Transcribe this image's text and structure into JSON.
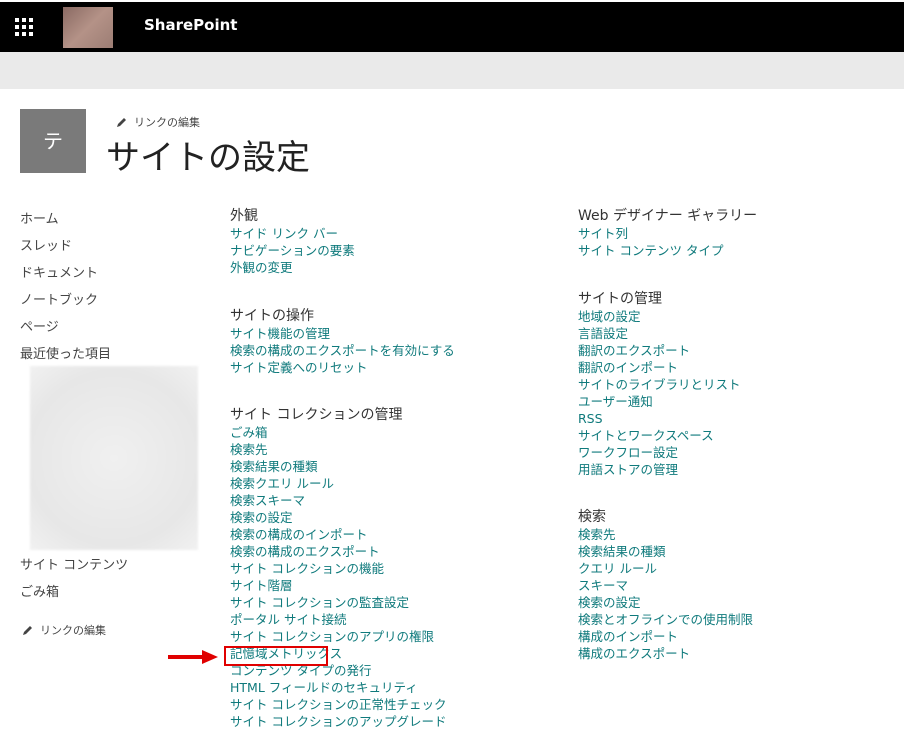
{
  "suite": {
    "title": "SharePoint"
  },
  "site": {
    "logo_letter": "テ",
    "page_title": "サイトの設定",
    "edit_links": "リンクの編集"
  },
  "left_nav": {
    "items": [
      "ホーム",
      "スレッド",
      "ドキュメント",
      "ノートブック",
      "ページ",
      "最近使った項目"
    ],
    "bottom_items": [
      "サイト コンテンツ",
      "ごみ箱"
    ],
    "edit_links": "リンクの編集"
  },
  "sections": {
    "appearance": {
      "title": "外観",
      "links": [
        "サイド リンク バー",
        "ナビゲーションの要素",
        "外観の変更"
      ]
    },
    "site_actions": {
      "title": "サイトの操作",
      "links": [
        "サイト機能の管理",
        "検索の構成のエクスポートを有効にする",
        "サイト定義へのリセット"
      ]
    },
    "site_collection_admin": {
      "title": "サイト コレクションの管理",
      "links": [
        "ごみ箱",
        "検索先",
        "検索結果の種類",
        "検索クエリ ルール",
        "検索スキーマ",
        "検索の設定",
        "検索の構成のインポート",
        "検索の構成のエクスポート",
        "サイト コレクションの機能",
        "サイト階層",
        "サイト コレクションの監査設定",
        "ポータル サイト接続",
        "サイト コレクションのアプリの権限",
        "記憶域メトリックス",
        "コンテンツ タイプの発行",
        "HTML フィールドのセキュリティ",
        "サイト コレクションの正常性チェック",
        "サイト コレクションのアップグレード"
      ]
    },
    "web_designer": {
      "title": "Web デザイナー ギャラリー",
      "links": [
        "サイト列",
        "サイト コンテンツ タイプ"
      ]
    },
    "site_admin": {
      "title": "サイトの管理",
      "links": [
        "地域の設定",
        "言語設定",
        "翻訳のエクスポート",
        "翻訳のインポート",
        "サイトのライブラリとリスト",
        "ユーザー通知",
        "RSS",
        "サイトとワークスペース",
        "ワークフロー設定",
        "用語ストアの管理"
      ]
    },
    "search": {
      "title": "検索",
      "links": [
        "検索先",
        "検索結果の種類",
        "クエリ ルール",
        "スキーマ",
        "検索の設定",
        "検索とオフラインでの使用制限",
        "構成のインポート",
        "構成のエクスポート"
      ]
    }
  },
  "colors": {
    "link": "#0f7a7c",
    "highlight": "#e00000",
    "topbar": "#000000",
    "ribbon": "#eaeaea"
  },
  "highlighted_link": "記憶域メトリックス"
}
